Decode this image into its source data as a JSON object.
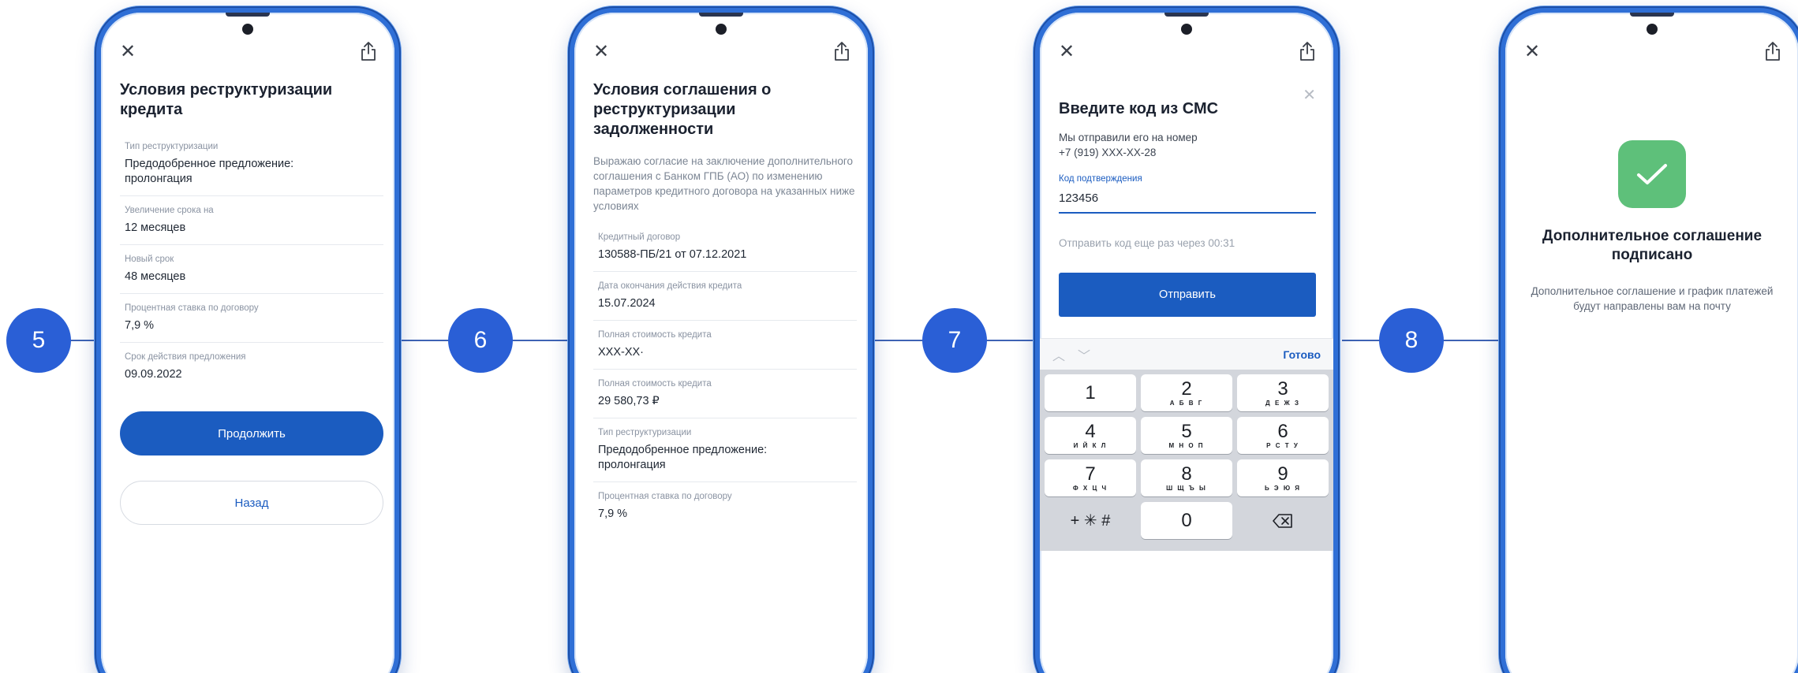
{
  "steps": [
    "5",
    "6",
    "7",
    "8"
  ],
  "colors": {
    "accent": "#1b5cc0",
    "phone_frame": "#2f6fd6",
    "step_circle": "#2a5fd6",
    "success": "#5ec07a"
  },
  "icons": {
    "close": "close-icon",
    "share": "share-icon",
    "check": "checkmark-icon",
    "backspace": "backspace-icon"
  },
  "screen5": {
    "title": "Условия реструктуризации кредита",
    "fields": [
      {
        "label": "Тип реструктуризации",
        "value": "Предодобренное предложение: пролонгация"
      },
      {
        "label": "Увеличение срока на",
        "value": "12 месяцев"
      },
      {
        "label": "Новый срок",
        "value": "48 месяцев"
      },
      {
        "label": "Процентная ставка по договору",
        "value": "7,9 %"
      },
      {
        "label": "Срок действия предложения",
        "value": "09.09.2022"
      }
    ],
    "continue_label": "Продолжить",
    "back_label": "Назад"
  },
  "screen6": {
    "title": "Условия соглашения о реструктуризации задолженности",
    "intro": "Выражаю согласие на заключение дополнительного соглашения с Банком ГПБ (АО) по изменению параметров кредитного договора на указанных ниже условиях",
    "fields": [
      {
        "label": "Кредитный договор",
        "value": "130588-ПБ/21 от 07.12.2021"
      },
      {
        "label": "Дата окончания действия кредита",
        "value": "15.07.2024"
      },
      {
        "label": "Полная стоимость кредита",
        "value": "XXX-XX·"
      },
      {
        "label": "Полная стоимость кредита",
        "value": "29 580,73 ₽"
      },
      {
        "label": "Тип реструктуризации",
        "value": "Предодобренное предложение: пролонгация"
      },
      {
        "label": "Процентная ставка по договору",
        "value": "7,9 %"
      }
    ]
  },
  "screen7": {
    "title": "Введите код из СМС",
    "subtitle_line1": "Мы отправили его на номер",
    "subtitle_line2": "+7 (919) XXX-XX-28",
    "code_label": "Код подтверждения",
    "code_value": "123456",
    "resend_text": "Отправить код еще раз через 00:31",
    "submit_label": "Отправить",
    "keyboard_done": "Готово",
    "keys": [
      {
        "digit": "1",
        "letters": ""
      },
      {
        "digit": "2",
        "letters": "А Б В Г"
      },
      {
        "digit": "3",
        "letters": "Д Е Ж З"
      },
      {
        "digit": "4",
        "letters": "И Й К Л"
      },
      {
        "digit": "5",
        "letters": "М Н О П"
      },
      {
        "digit": "6",
        "letters": "Р С Т У"
      },
      {
        "digit": "7",
        "letters": "Ф Х Ц Ч"
      },
      {
        "digit": "8",
        "letters": "Ш Щ Ъ Ы"
      },
      {
        "digit": "9",
        "letters": "Ь Э Ю Я"
      }
    ],
    "key_symbols": "+ ✳ #",
    "key_zero": "0"
  },
  "screen8": {
    "title": "Дополнительное соглашение подписано",
    "text": "Дополнительное соглашение и график платежей будут направлены вам на почту"
  }
}
